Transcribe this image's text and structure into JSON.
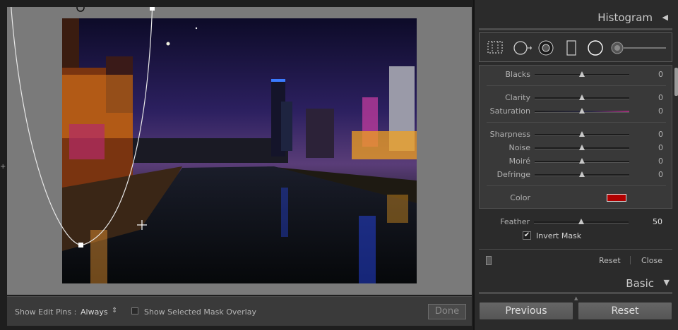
{
  "canvas": {
    "left_edge_marker": "+"
  },
  "toolbar": {
    "pins_label": "Show Edit Pins :",
    "pins_value": "Always",
    "pins_chevron": "⇕",
    "overlay_label": "Show Selected Mask Overlay",
    "overlay_checked": false,
    "done_label": "Done"
  },
  "panel": {
    "histogram_title": "Histogram",
    "histogram_toggle": "◀",
    "tools": [
      "crop-overlay-icon",
      "spot-removal-icon",
      "red-eye-icon",
      "graduated-filter-icon",
      "radial-filter-icon",
      "adjustment-brush-icon"
    ],
    "adjustments": [
      {
        "label": "Blacks",
        "value": "0",
        "position": 0.5
      },
      {
        "label": "Clarity",
        "value": "0",
        "position": 0.5
      },
      {
        "label": "Saturation",
        "value": "0",
        "position": 0.5
      },
      {
        "label": "Sharpness",
        "value": "0",
        "position": 0.5
      },
      {
        "label": "Noise",
        "value": "0",
        "position": 0.5
      },
      {
        "label": "Moiré",
        "value": "0",
        "position": 0.5
      },
      {
        "label": "Defringe",
        "value": "0",
        "position": 0.5
      }
    ],
    "color_label": "Color",
    "color_value": "#b00000",
    "feather_label": "Feather",
    "feather_value": "50",
    "feather_position": 0.5,
    "invert_mask_label": "Invert Mask",
    "invert_mask_checked": true,
    "invert_mask_mark": "✔",
    "reset_label": "Reset",
    "close_label": "Close",
    "basic_title": "Basic",
    "basic_toggle": "▼",
    "scroll_notch": "▲",
    "previous_button": "Previous",
    "reset_button": "Reset"
  },
  "colors": {
    "panel_bg": "#2b2b2b",
    "canvas_bg": "#7a7a7a",
    "accent_red": "#b00000"
  }
}
